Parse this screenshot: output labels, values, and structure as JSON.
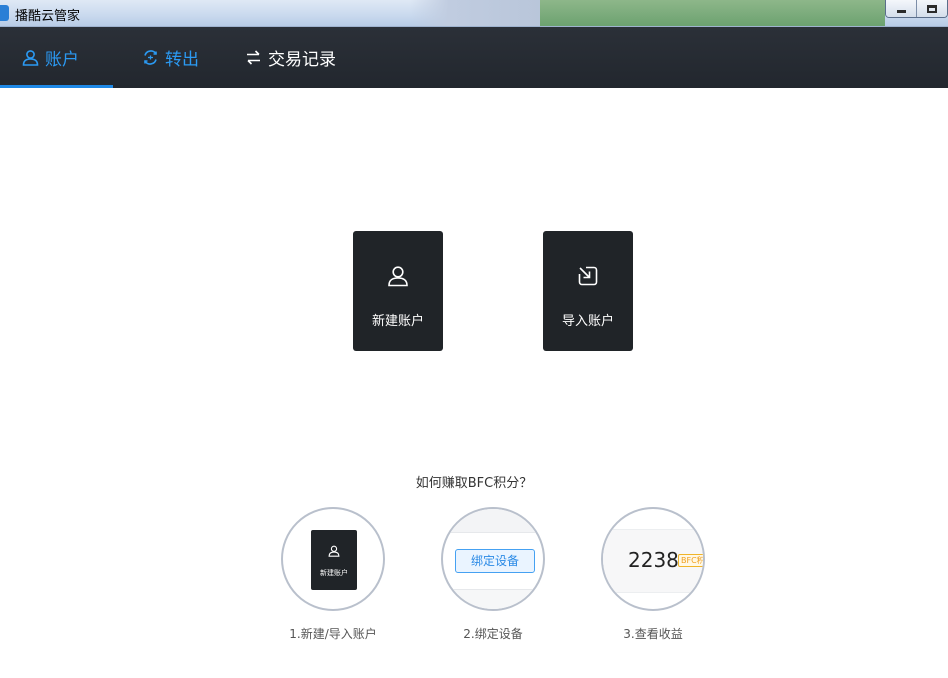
{
  "window": {
    "title": "播酷云管家"
  },
  "nav": {
    "tabs": [
      {
        "label": "账户",
        "icon": "user-icon",
        "active": true
      },
      {
        "label": "转出",
        "icon": "exchange-cycle-icon",
        "active": false
      },
      {
        "label": "交易记录",
        "icon": "swap-arrows-icon",
        "active": false
      }
    ]
  },
  "actions": {
    "new_account": {
      "label": "新建账户",
      "icon": "user-icon"
    },
    "import_account": {
      "label": "导入账户",
      "icon": "import-icon"
    }
  },
  "help": {
    "title": "如何赚取BFC积分？",
    "steps": [
      {
        "caption": "1.新建/导入账户",
        "preview_label": "新建账户"
      },
      {
        "caption": "2.绑定设备",
        "preview_button": "绑定设备"
      },
      {
        "caption": "3.查看收益",
        "preview_value": "2238",
        "preview_badge": "BFC积"
      }
    ]
  },
  "colors": {
    "accent": "#2b9af3",
    "nav_bg": "#22272e",
    "card_bg": "#202428",
    "badge": "#f0b429"
  }
}
